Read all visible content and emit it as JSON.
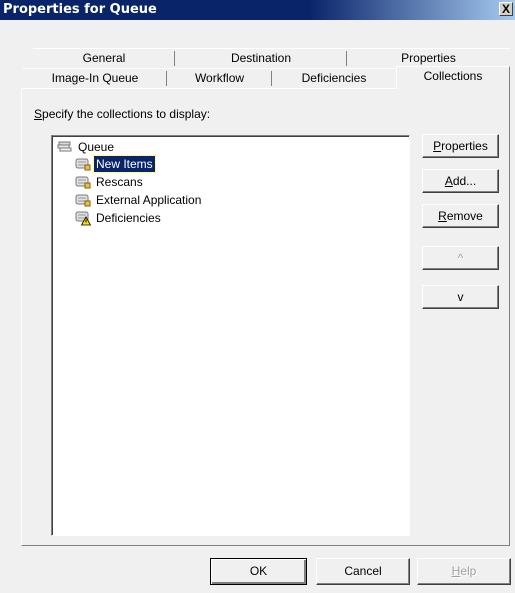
{
  "window": {
    "title": "Properties for Queue",
    "close_glyph": "X"
  },
  "tabs": {
    "row1": [
      {
        "label": "General"
      },
      {
        "label": "Destination"
      },
      {
        "label": "Properties"
      }
    ],
    "row2": [
      {
        "label": "Image-In Queue"
      },
      {
        "label": "Workflow"
      },
      {
        "label": "Deficiencies"
      },
      {
        "label": "Collections",
        "active": true
      }
    ]
  },
  "panel": {
    "instruction_mnemonic": "S",
    "instruction_rest": "pecify the collections to display:"
  },
  "tree": {
    "root": {
      "label": "Queue",
      "icon": "queue-icon"
    },
    "children": [
      {
        "label": "New Items",
        "icon": "collection-icon",
        "selected": true
      },
      {
        "label": "Rescans",
        "icon": "collection-icon"
      },
      {
        "label": "External Application",
        "icon": "collection-icon"
      },
      {
        "label": "Deficiencies",
        "icon": "collection-warning-icon"
      }
    ]
  },
  "side_buttons": {
    "properties": {
      "mnemonic": "P",
      "rest": "roperties"
    },
    "add": {
      "mnemonic": "A",
      "rest": "dd..."
    },
    "remove": {
      "mnemonic": "R",
      "rest": "emove"
    },
    "up": {
      "label": "^",
      "disabled": true
    },
    "down": {
      "label": "v"
    }
  },
  "footer": {
    "ok": "OK",
    "cancel": "Cancel",
    "help_mnemonic": "H",
    "help_rest": "elp",
    "help_disabled": true
  },
  "colors": {
    "title_bar": "#0a246a",
    "selection": "#0a246a",
    "face": "#f0f0f0"
  }
}
